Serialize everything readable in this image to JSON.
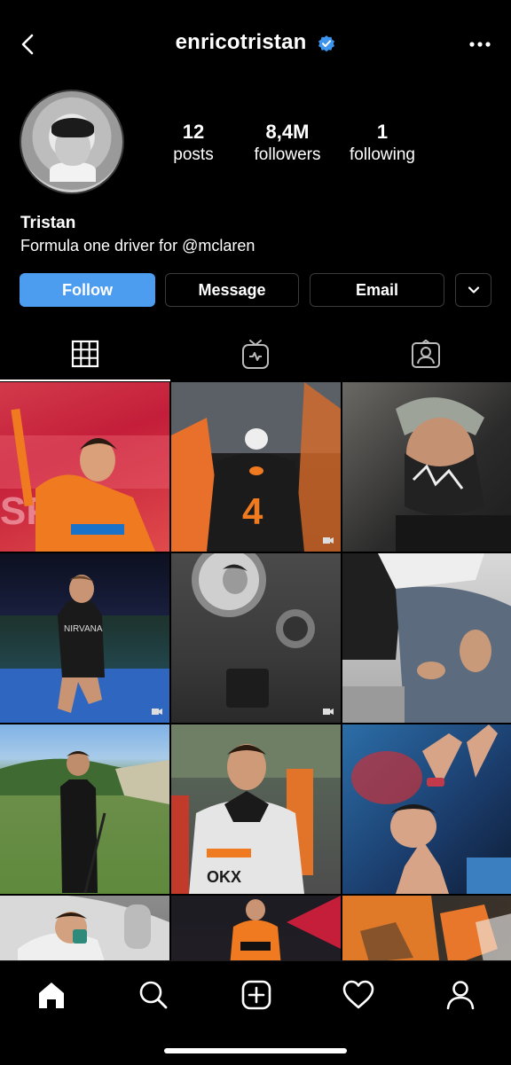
{
  "header": {
    "username": "enricotristan",
    "verified": true,
    "back_icon": "chevron-left-icon",
    "more_icon": "more-horizontal-icon"
  },
  "profile": {
    "stats": [
      {
        "value": "12",
        "label": "posts"
      },
      {
        "value": "8,4M",
        "label": "followers"
      },
      {
        "value": "1",
        "label": "following"
      }
    ],
    "name": "Tristan",
    "bio": "Formula one driver for @mclaren"
  },
  "actions": {
    "follow_label": "Follow",
    "message_label": "Message",
    "email_label": "Email",
    "more_icon": "chevron-down-icon"
  },
  "tabs": [
    {
      "icon": "grid-icon",
      "active": true
    },
    {
      "icon": "igtv-icon",
      "active": false
    },
    {
      "icon": "tagged-icon",
      "active": false
    }
  ],
  "grid": {
    "post_icon": "reel-icon"
  },
  "bottom_nav": [
    {
      "icon": "home-icon"
    },
    {
      "icon": "search-icon"
    },
    {
      "icon": "new-post-icon"
    },
    {
      "icon": "heart-icon"
    },
    {
      "icon": "profile-icon"
    }
  ],
  "colors": {
    "background": "#000000",
    "follow_button": "#4c9cf0",
    "verified_badge": "#3d95ef",
    "border": "#3b3b3b"
  }
}
